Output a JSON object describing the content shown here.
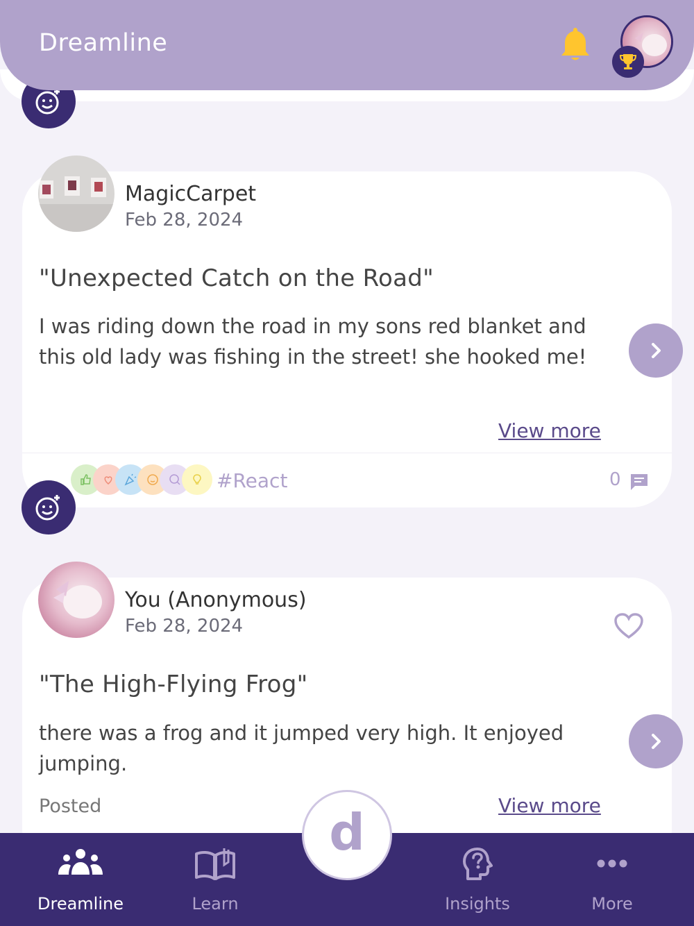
{
  "header": {
    "title": "Dreamline",
    "bell_icon": "bell-icon",
    "trophy_icon": "trophy-icon",
    "accent_color": "#b0a2cb"
  },
  "posts": [
    {
      "username": "MagicCarpet",
      "date": "Feb 28, 2024",
      "title": "\"Unexpected Catch on the Road\"",
      "body": "I was riding down the road in my sons red blanket and this old lady was fishing in the street!  she hooked me!",
      "view_more": "View more",
      "react_tag": "#React",
      "comment_count": "0"
    },
    {
      "username": "You (Anonymous)",
      "date": "Feb 28, 2024",
      "title": "\"The High-Flying Frog\"",
      "body": "there was a frog and it jumped very high. It enjoyed jumping.",
      "status": "Posted",
      "view_more": "View more"
    }
  ],
  "center_button": {
    "letter": "d"
  },
  "bottom_nav": [
    {
      "label": "Dreamline",
      "active": true,
      "icon": "community-icon"
    },
    {
      "label": "Learn",
      "active": false,
      "icon": "book-icon"
    },
    {
      "label": "Insights",
      "active": false,
      "icon": "insight-icon"
    },
    {
      "label": "More",
      "active": false,
      "icon": "more-dots-icon"
    }
  ]
}
